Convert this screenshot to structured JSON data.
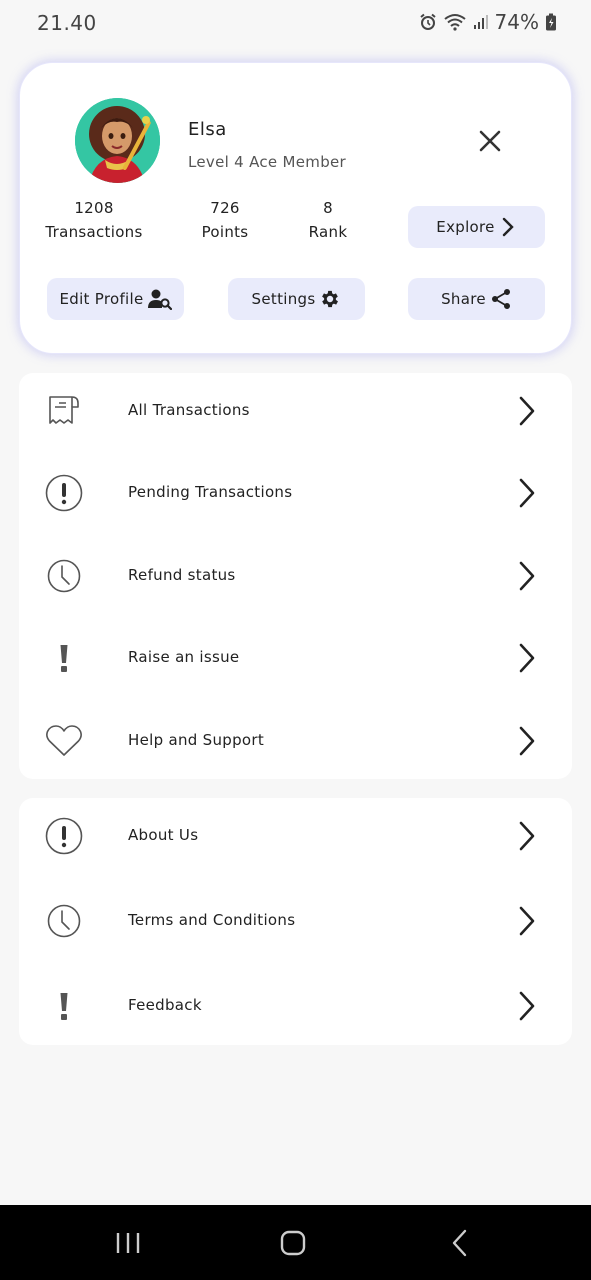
{
  "status_bar": {
    "time": "21.40",
    "battery": "74%"
  },
  "profile": {
    "name": "Elsa",
    "level": "Level 4 Ace Member",
    "stats": [
      {
        "value": "1208",
        "label": "Transactions"
      },
      {
        "value": "726",
        "label": "Points"
      },
      {
        "value": "8",
        "label": "Rank"
      }
    ],
    "buttons": {
      "explore": "Explore",
      "edit_profile": "Edit Profile",
      "settings": "Settings",
      "share": "Share"
    }
  },
  "menu_primary": [
    {
      "label": "All Transactions",
      "icon": "receipt-icon"
    },
    {
      "label": "Pending Transactions",
      "icon": "alert-circle-icon"
    },
    {
      "label": "Refund status",
      "icon": "clock-icon"
    },
    {
      "label": "Raise an issue",
      "icon": "exclamation-icon"
    },
    {
      "label": "Help and Support",
      "icon": "heart-icon"
    }
  ],
  "menu_secondary": [
    {
      "label": "About Us",
      "icon": "alert-circle-icon"
    },
    {
      "label": "Terms and Conditions",
      "icon": "clock-icon"
    },
    {
      "label": "Feedback",
      "icon": "exclamation-icon"
    }
  ],
  "colors": {
    "background": "#f7f7f7",
    "card": "#ffffff",
    "pill": "#e9ebfb",
    "card_glow": "#aaaaf0",
    "nav_bar": "#000000"
  }
}
